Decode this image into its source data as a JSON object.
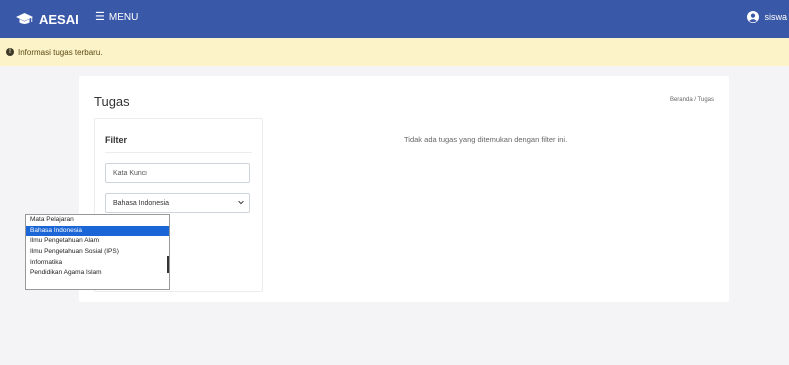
{
  "navbar": {
    "brand": "AESAI",
    "brand_icon": "graduation-cap-icon",
    "menu_icon": "menu-bars-icon",
    "menu_label": "MENU",
    "user_icon": "user-circle-icon",
    "user_name": "siswa",
    "bg_color": "#3a58a8"
  },
  "alert": {
    "icon": "info-circle-icon",
    "text": "Informasi tugas terbaru.",
    "bg_color": "#fdf3c8"
  },
  "page": {
    "title": "Tugas",
    "breadcrumb": "Beranda / Tugas",
    "empty_message": "Tidak ada tugas yang ditemukan dengan filter ini."
  },
  "filter": {
    "title": "Filter",
    "keyword_placeholder": "Kata Kunci",
    "keyword_value": "",
    "subject_selected": "Bahasa Indonesia",
    "subject_options": [
      "Mata Pelajaran",
      "Bahasa Indonesia",
      "Ilmu Pengetahuan Alam",
      "Ilmu Pengetahuan Sosial (IPS)",
      "Informatika",
      "Pendidikan Agama Islam"
    ],
    "subject_selected_index": 1,
    "highlight_color": "#1a66d6"
  }
}
